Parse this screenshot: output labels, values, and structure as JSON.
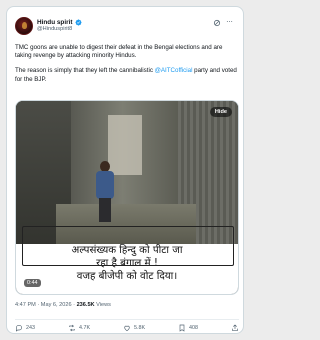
{
  "header": {
    "name": "Hindu spirit",
    "handle": "@Hinduspirit8"
  },
  "tweet": {
    "paragraph1": "TMC goons are unable to digest their defeat in the Bengal elections and are taking revenge by attacking minority Hindus.",
    "paragraph2_before": "The reason is simply that they left the cannibalistic ",
    "paragraph2_mention": "@AITCofficial",
    "paragraph2_after": " party and voted for the BJP."
  },
  "media": {
    "hide_label": "Hide",
    "caption_lines": [
      "अल्पसंख्यक हिन्दु को पीटा जा",
      "रहा है बंगाल में !",
      "वजह बीजेपी को वोट दिया।"
    ],
    "timer": "0:44"
  },
  "meta": {
    "time": "4:47 PM · May 6, 2026 · ",
    "views": "236.5K",
    "views_label": " Views"
  },
  "actions": {
    "replies": "243",
    "reposts": "4.7K",
    "likes": "5.8K",
    "bookmarks": "408"
  },
  "colors": {
    "accent": "#1d9bf0",
    "text": "#0f1419",
    "muted": "#536471"
  }
}
